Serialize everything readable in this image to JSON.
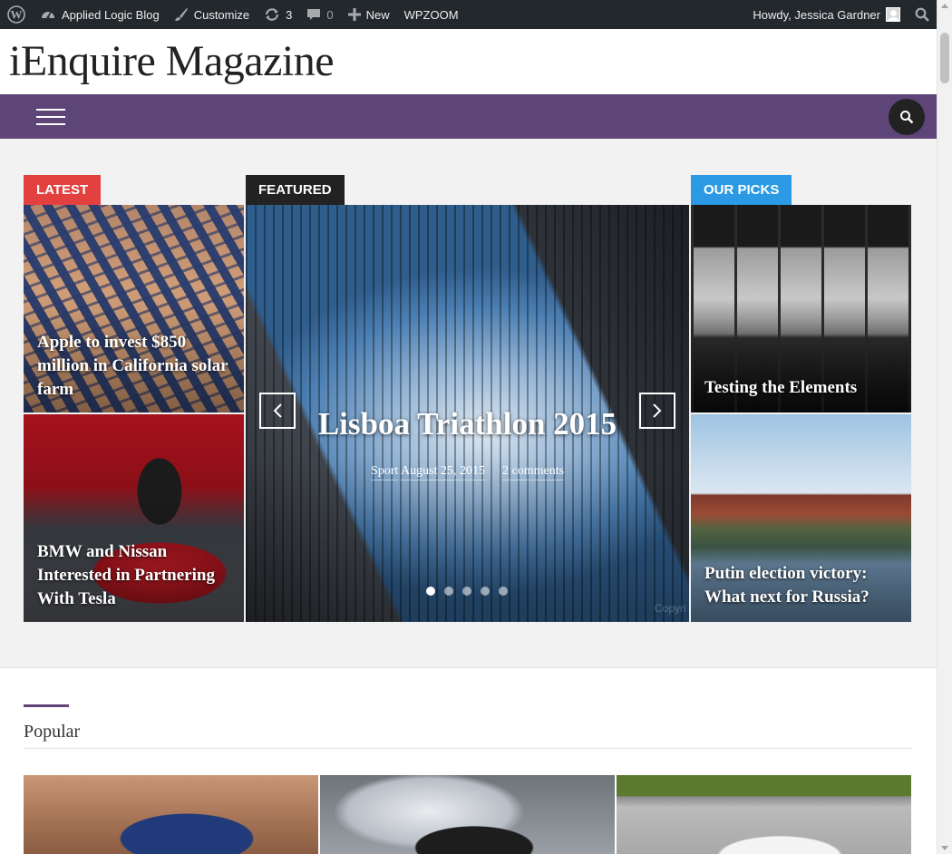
{
  "admin_bar": {
    "site_name": "Applied Logic Blog",
    "customize": "Customize",
    "updates_count": "3",
    "comments_count": "0",
    "new_label": "New",
    "wpzoom": "WPZOOM",
    "greeting": "Howdy, Jessica Gardner"
  },
  "site": {
    "title": "iEnquire Magazine"
  },
  "sections": {
    "latest_tag": "LATEST",
    "featured_tag": "FEATURED",
    "picks_tag": "OUR PICKS"
  },
  "latest": [
    {
      "title": "Apple to invest $850 million in California solar farm"
    },
    {
      "title": "BMW and Nissan Interested in Partnering With Tesla"
    }
  ],
  "featured": {
    "title": "Lisboa Triathlon 2015",
    "category": "Sport",
    "date": "August 25, 2015",
    "comments": "2 comments",
    "slide_count": 5,
    "active_slide": 1,
    "watermark": "Copyri"
  },
  "picks": [
    {
      "title": "Testing the Elements"
    },
    {
      "title": "Putin election victory: What next for Russia?"
    }
  ],
  "popular": {
    "heading": "Popular"
  },
  "colors": {
    "latest": "#e34040",
    "featured": "#222222",
    "picks": "#2b99e3",
    "nav": "#5e4577"
  }
}
